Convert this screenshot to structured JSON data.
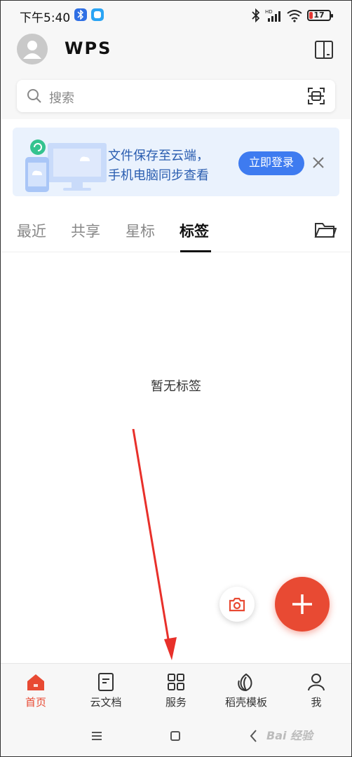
{
  "status_bar": {
    "time": "下午5:40",
    "battery": "17",
    "network": "HD"
  },
  "header": {
    "logo": "WPS"
  },
  "search": {
    "placeholder": "搜索"
  },
  "banner": {
    "line1": "文件保存至云端，",
    "line2": "手机电脑同步查看",
    "login_label": "立即登录"
  },
  "tabs": [
    {
      "label": "最近"
    },
    {
      "label": "共享"
    },
    {
      "label": "星标"
    },
    {
      "label": "标签"
    }
  ],
  "active_tab": "标签",
  "empty_state": "暂无标签",
  "bottom_nav": [
    {
      "label": "首页",
      "icon": "home-icon"
    },
    {
      "label": "云文档",
      "icon": "document-icon"
    },
    {
      "label": "服务",
      "icon": "grid-icon"
    },
    {
      "label": "稻壳模板",
      "icon": "leaf-icon"
    },
    {
      "label": "我",
      "icon": "person-icon"
    }
  ],
  "watermark": "Bai 经验",
  "colors": {
    "accent": "#e84a33",
    "banner_bg": "#eaf2fd",
    "banner_text": "#2a5db0",
    "login_button": "#3e7bf0"
  }
}
